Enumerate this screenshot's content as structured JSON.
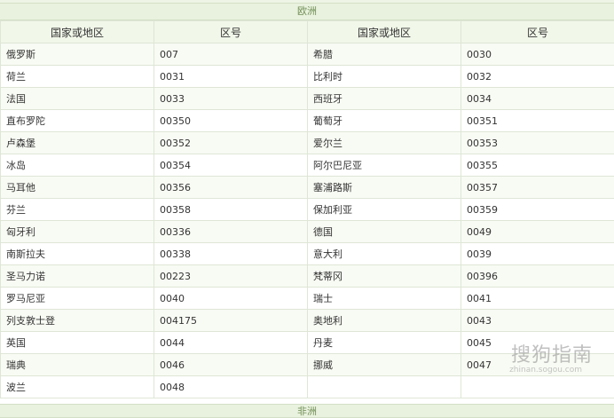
{
  "region_title": "欧洲",
  "next_region_title": "非洲",
  "headers": [
    "国家或地区",
    "区号",
    "国家或地区",
    "区号"
  ],
  "rows": [
    [
      "俄罗斯",
      "007",
      "希腊",
      "0030"
    ],
    [
      "荷兰",
      "0031",
      "比利时",
      "0032"
    ],
    [
      "法国",
      "0033",
      "西班牙",
      "0034"
    ],
    [
      "直布罗陀",
      "00350",
      "葡萄牙",
      "00351"
    ],
    [
      "卢森堡",
      "00352",
      "爱尔兰",
      "00353"
    ],
    [
      "冰岛",
      "00354",
      "阿尔巴尼亚",
      "00355"
    ],
    [
      "马耳他",
      "00356",
      "塞浦路斯",
      "00357"
    ],
    [
      "芬兰",
      "00358",
      "保加利亚",
      "00359"
    ],
    [
      "匈牙利",
      "00336",
      "德国",
      "0049"
    ],
    [
      "南斯拉夫",
      "00338",
      "意大利",
      "0039"
    ],
    [
      "圣马力诺",
      "00223",
      "梵蒂冈",
      "00396"
    ],
    [
      "罗马尼亚",
      "0040",
      "瑞士",
      "0041"
    ],
    [
      "列支敦士登",
      "004175",
      "奥地利",
      "0043"
    ],
    [
      "英国",
      "0044",
      "丹麦",
      "0045"
    ],
    [
      "瑞典",
      "0046",
      "挪威",
      "0047"
    ],
    [
      "波兰",
      "0048",
      "",
      ""
    ]
  ],
  "watermark": {
    "main": "搜狗指南",
    "sub": "zhinan.sogou.com"
  }
}
